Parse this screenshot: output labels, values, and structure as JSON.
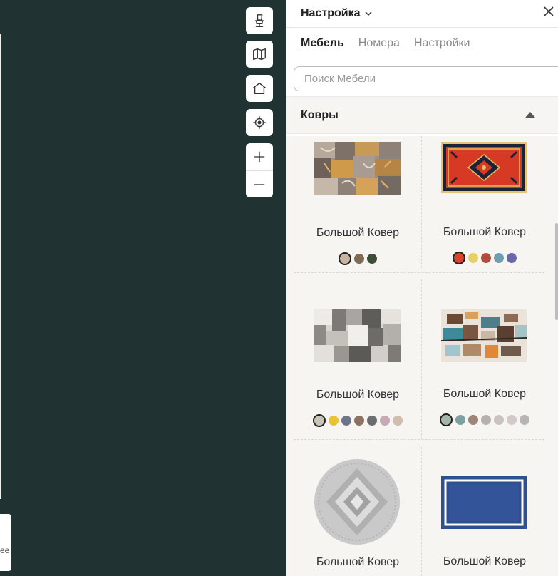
{
  "viewport": {
    "mini_card_label": "ee"
  },
  "toolbar": {
    "buttons": [
      {
        "name": "chair-icon"
      },
      {
        "name": "map-icon"
      },
      {
        "name": "home-icon"
      },
      {
        "name": "locate-icon"
      }
    ],
    "zoom_in": "plus-icon",
    "zoom_out": "minus-icon"
  },
  "panel": {
    "title": "Настройка",
    "tabs": [
      {
        "label": "Мебель",
        "active": true
      },
      {
        "label": "Номера",
        "active": false
      },
      {
        "label": "Настройки",
        "active": false
      }
    ],
    "search": {
      "placeholder": "Поиск Мебели",
      "value": ""
    },
    "section": {
      "title": "Ковры",
      "expanded": true
    },
    "items": [
      {
        "name": "Большой Ковер",
        "swatches": [
          "#c9b29f",
          "#7e6a55",
          "#3c4d36"
        ],
        "selected": 0
      },
      {
        "name": "Большой Ковер",
        "swatches": [
          "#d9452c",
          "#e8cf6a",
          "#b04d3c",
          "#6d9fb0",
          "#6b67a8"
        ],
        "selected": 0
      },
      {
        "name": "Большой Ковер",
        "swatches": [
          "#c8c4b8",
          "#e8c33a",
          "#6f7588",
          "#8c7465",
          "#6c6d70",
          "#c8aab5",
          "#d1bcae"
        ],
        "selected": 0
      },
      {
        "name": "Большой Ковер",
        "swatches": [
          "#a5b5a9",
          "#7f9fa1",
          "#9a8577",
          "#b7b1ad",
          "#c9c4c2",
          "#d3c9c8",
          "#b9b4b4"
        ],
        "selected": 0
      },
      {
        "name": "Большой Ковер",
        "swatches": [],
        "selected": -1
      },
      {
        "name": "Большой Ковер",
        "swatches": [],
        "selected": -1
      }
    ]
  },
  "colors": {
    "canvas_bg": "#213232",
    "panel_bg": "#ffffff",
    "grid_bg": "#f7f5f2"
  }
}
